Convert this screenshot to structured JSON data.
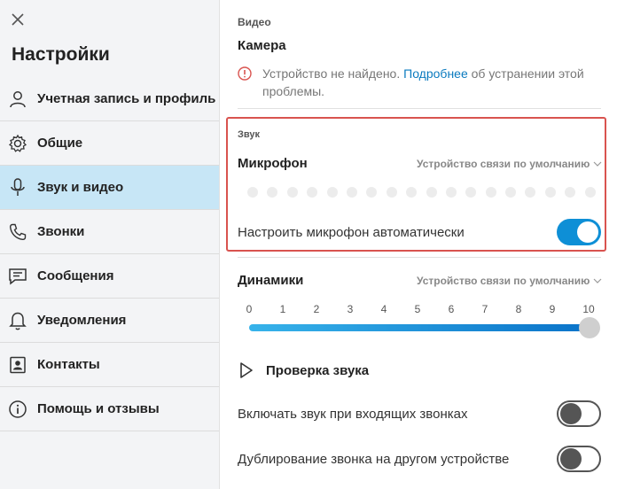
{
  "sidebar": {
    "title": "Настройки",
    "items": [
      {
        "label": "Учетная запись и профиль",
        "icon": "person-icon"
      },
      {
        "label": "Общие",
        "icon": "gear-icon"
      },
      {
        "label": "Звук и видео",
        "icon": "microphone-icon",
        "active": true
      },
      {
        "label": "Звонки",
        "icon": "phone-icon"
      },
      {
        "label": "Сообщения",
        "icon": "message-icon"
      },
      {
        "label": "Уведомления",
        "icon": "bell-icon"
      },
      {
        "label": "Контакты",
        "icon": "contacts-icon"
      },
      {
        "label": "Помощь и отзывы",
        "icon": "info-icon"
      }
    ]
  },
  "video": {
    "section_label": "Видео",
    "camera_label": "Камера",
    "warning_text": "Устройство не найдено.",
    "warning_link": "Подробнее",
    "warning_rest": "об устранении этой проблемы."
  },
  "sound": {
    "section_label": "Звук",
    "mic_label": "Микрофон",
    "mic_device": "Устройство связи по умолчанию",
    "auto_mic_label": "Настроить микрофон автоматически",
    "auto_mic_on": true,
    "speakers_label": "Динамики",
    "speakers_device": "Устройство связи по умолчанию",
    "volume_ticks": [
      "0",
      "1",
      "2",
      "3",
      "4",
      "5",
      "6",
      "7",
      "8",
      "9",
      "10"
    ],
    "volume_value": 10,
    "test_sound_label": "Проверка звука",
    "incoming_ring_label": "Включать звук при входящих звонках",
    "incoming_ring_on": false,
    "duplicate_ring_label": "Дублирование звонка на другом устройстве",
    "duplicate_ring_on": false
  },
  "colors": {
    "accent": "#0e8fd6",
    "active_nav": "#c7e6f6",
    "highlight_border": "#d9534f",
    "warning": "#d9534f",
    "link": "#0a7abf"
  }
}
